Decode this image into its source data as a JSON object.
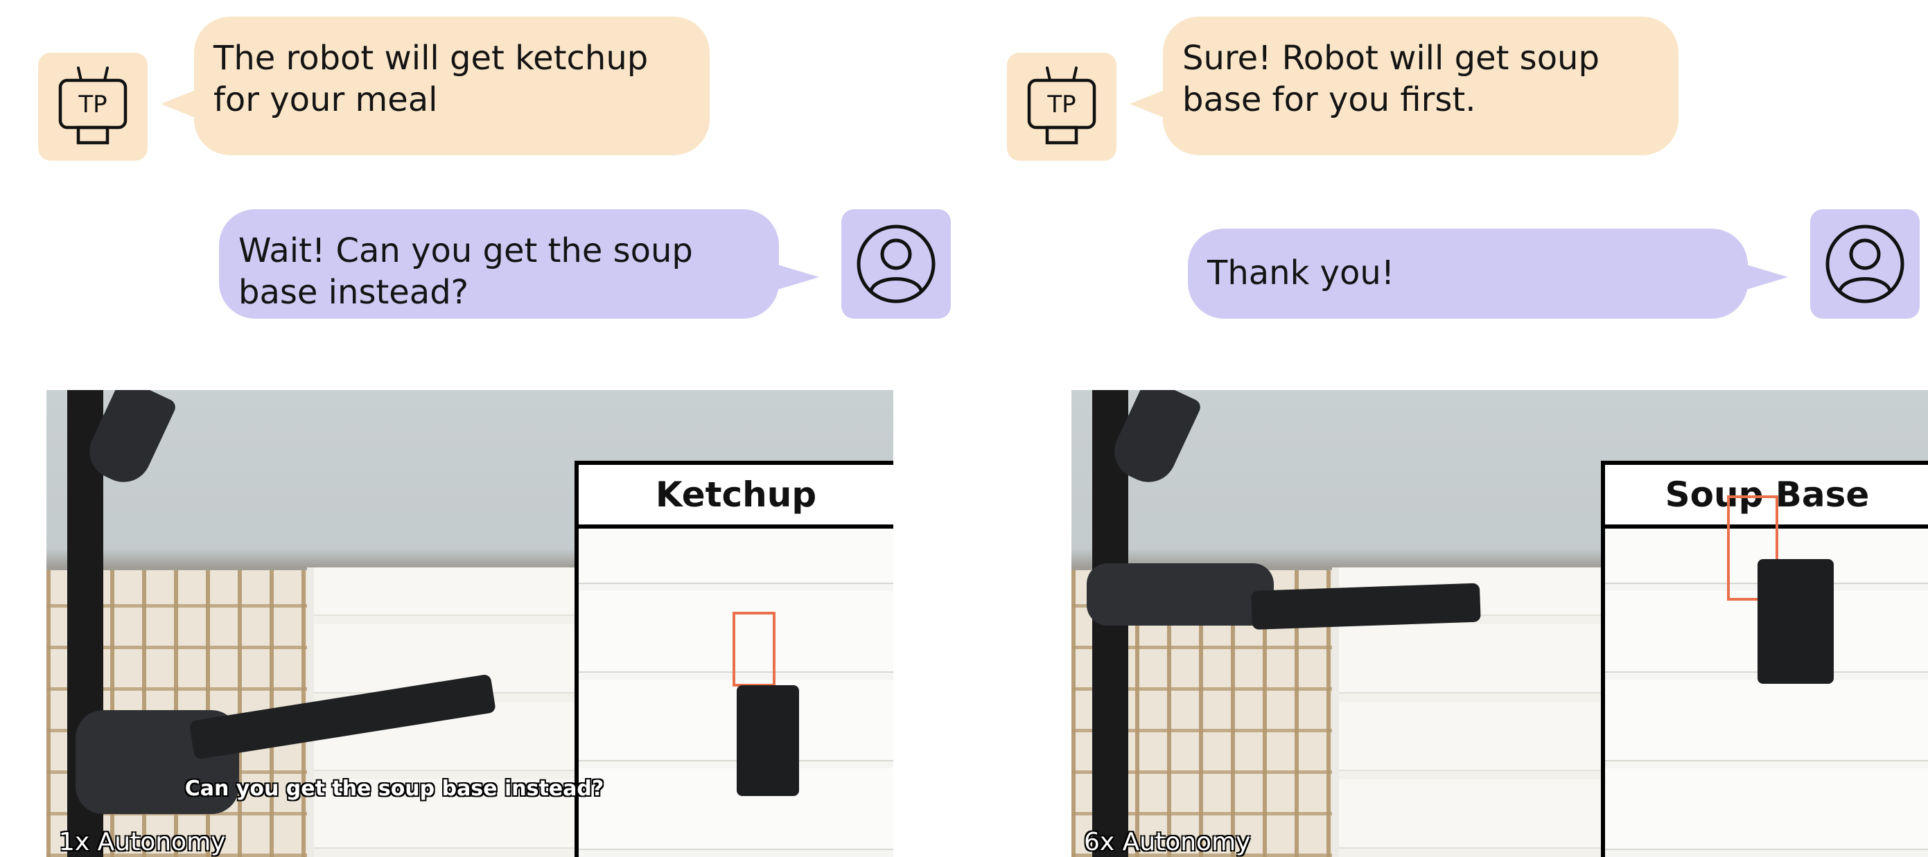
{
  "left_panel": {
    "robot_message": "The robot will get ketchup\nfor your meal",
    "user_message": "Wait! Can you get the soup\nbase instead?",
    "robot_avatar_text": "TP",
    "inset_title": "Ketchup",
    "video_caption": "Can you get the soup base instead?",
    "autonomy_label": "1x Autonomy"
  },
  "right_panel": {
    "robot_message": "Sure! Robot will get soup\nbase for you first.",
    "user_message": "Thank you!",
    "robot_avatar_text": "TP",
    "inset_title": "Soup Base",
    "autonomy_label": "6x Autonomy"
  },
  "colors": {
    "robot_bubble": "#fae5c8",
    "user_bubble": "#cfcaf3",
    "highlight_box": "#e9704b"
  },
  "icons": {
    "robot": "robot-tp-icon",
    "user": "user-avatar-icon"
  }
}
